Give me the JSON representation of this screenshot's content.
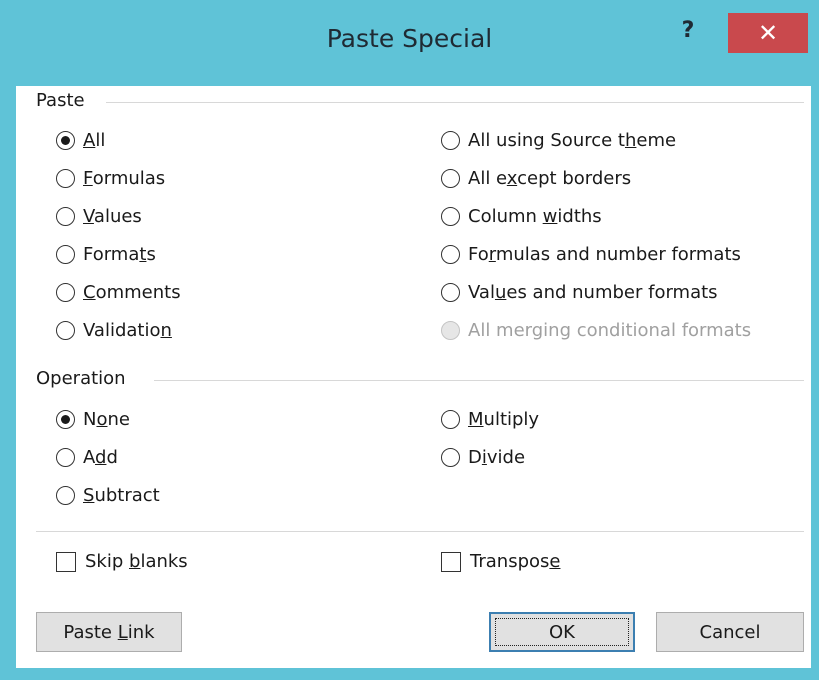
{
  "window": {
    "title": "Paste Special",
    "help_label": "?",
    "close_label": "✕"
  },
  "paste": {
    "section_label": "Paste",
    "left_options": [
      {
        "pre": "",
        "ul": "A",
        "post": "ll",
        "checked": true
      },
      {
        "pre": "",
        "ul": "F",
        "post": "ormulas",
        "checked": false
      },
      {
        "pre": "",
        "ul": "V",
        "post": "alues",
        "checked": false
      },
      {
        "pre": "Forma",
        "ul": "t",
        "post": "s",
        "checked": false
      },
      {
        "pre": "",
        "ul": "C",
        "post": "omments",
        "checked": false
      },
      {
        "pre": "Validatio",
        "ul": "n",
        "post": "",
        "checked": false
      }
    ],
    "right_options": [
      {
        "pre": "All using Source t",
        "ul": "h",
        "post": "eme",
        "checked": false,
        "disabled": false
      },
      {
        "pre": "All e",
        "ul": "x",
        "post": "cept borders",
        "checked": false,
        "disabled": false
      },
      {
        "pre": "Column ",
        "ul": "w",
        "post": "idths",
        "checked": false,
        "disabled": false
      },
      {
        "pre": "Fo",
        "ul": "r",
        "post": "mulas and number formats",
        "checked": false,
        "disabled": false
      },
      {
        "pre": "Val",
        "ul": "u",
        "post": "es and number formats",
        "checked": false,
        "disabled": false
      },
      {
        "pre": "All merging conditional formats",
        "ul": "",
        "post": "",
        "checked": false,
        "disabled": true
      }
    ]
  },
  "operation": {
    "section_label": "Operation",
    "left_options": [
      {
        "pre": "N",
        "ul": "o",
        "post": "ne",
        "checked": true
      },
      {
        "pre": "A",
        "ul": "d",
        "post": "d",
        "checked": false
      },
      {
        "pre": "",
        "ul": "S",
        "post": "ubtract",
        "checked": false
      }
    ],
    "right_options": [
      {
        "pre": "",
        "ul": "M",
        "post": "ultiply",
        "checked": false
      },
      {
        "pre": "D",
        "ul": "i",
        "post": "vide",
        "checked": false
      }
    ]
  },
  "checkboxes": {
    "skip_blanks": {
      "pre": "Skip ",
      "ul": "b",
      "post": "lanks",
      "checked": false
    },
    "transpose": {
      "pre": "Transpos",
      "ul": "e",
      "post": "",
      "checked": false
    }
  },
  "buttons": {
    "paste_link": {
      "pre": "Paste ",
      "ul": "L",
      "post": "ink"
    },
    "ok": "OK",
    "cancel": "Cancel"
  }
}
